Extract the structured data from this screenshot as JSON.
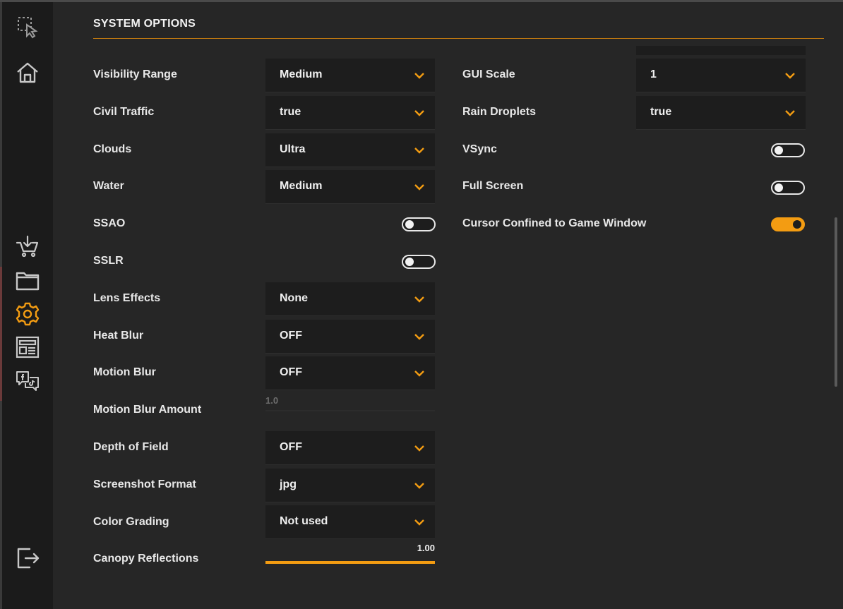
{
  "colors": {
    "accent": "#f39c12",
    "background": "#262626",
    "sidebar": "#1b1b1b",
    "control": "#1d1d1d"
  },
  "sidebar": {
    "items": [
      {
        "icon": "select-cursor-icon"
      },
      {
        "icon": "home-icon"
      },
      {
        "icon": "cart-download-icon"
      },
      {
        "icon": "folder-icon"
      },
      {
        "icon": "gear-icon",
        "active": true
      },
      {
        "icon": "newspaper-icon"
      },
      {
        "icon": "social-chat-icon"
      },
      {
        "icon": "logout-icon"
      }
    ]
  },
  "section": {
    "title": "SYSTEM OPTIONS"
  },
  "left_options": {
    "visibility_range": {
      "label": "Visibility Range",
      "value": "Medium"
    },
    "civil_traffic": {
      "label": "Civil Traffic",
      "value": "true"
    },
    "clouds": {
      "label": "Clouds",
      "value": "Ultra"
    },
    "water": {
      "label": "Water",
      "value": "Medium"
    },
    "ssao": {
      "label": "SSAO",
      "enabled": false
    },
    "sslr": {
      "label": "SSLR",
      "enabled": false
    },
    "lens_effects": {
      "label": "Lens Effects",
      "value": "None"
    },
    "heat_blur": {
      "label": "Heat Blur",
      "value": "OFF"
    },
    "motion_blur": {
      "label": "Motion Blur",
      "value": "OFF"
    },
    "motion_blur_amount": {
      "label": "Motion Blur Amount",
      "value_text": "1.0",
      "fraction": 0
    },
    "depth_of_field": {
      "label": "Depth of Field",
      "value": "OFF"
    },
    "screenshot_format": {
      "label": "Screenshot Format",
      "value": "jpg"
    },
    "color_grading": {
      "label": "Color Grading",
      "value": "Not used"
    },
    "canopy_reflections": {
      "label": "Canopy Reflections",
      "value_text": "1.00",
      "fraction": 1.0
    }
  },
  "right_options": {
    "gui_scale": {
      "label": "GUI Scale",
      "value": "1"
    },
    "rain_droplets": {
      "label": "Rain Droplets",
      "value": "true"
    },
    "vsync": {
      "label": "VSync",
      "enabled": false
    },
    "full_screen": {
      "label": "Full Screen",
      "enabled": false
    },
    "cursor_confined": {
      "label": "Cursor Confined to Game Window",
      "enabled": true
    }
  }
}
